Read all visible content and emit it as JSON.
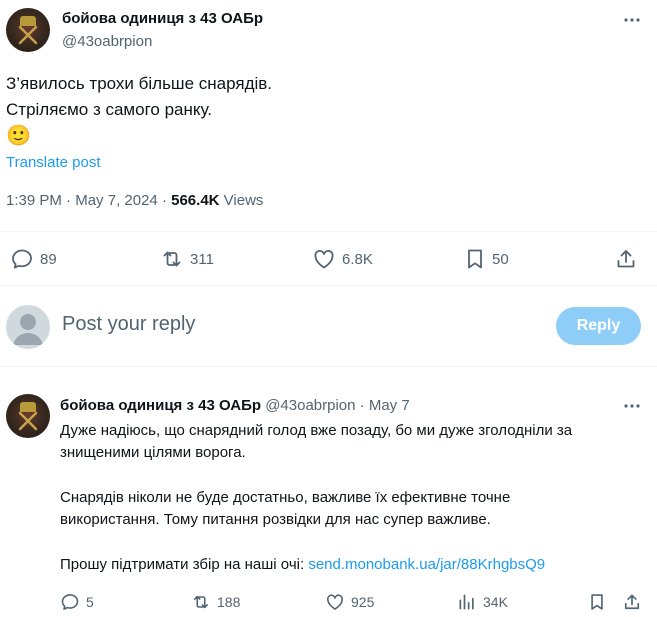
{
  "main_tweet": {
    "author_name": "бойова одиниця з 43 ОАБр",
    "handle": "@43oabrpion",
    "line1": "З’явилось трохи більше снарядів.",
    "line2": "Стріляємо з самого ранку.",
    "emoji": "🙂",
    "translate_label": "Translate post",
    "time": "1:39 PM",
    "dot": "·",
    "date": "May 7, 2024",
    "views_count": "566.4K",
    "views_label": "Views",
    "replies": "89",
    "reposts": "311",
    "likes": "6.8K",
    "bookmarks": "50"
  },
  "composer": {
    "placeholder": "Post your reply",
    "button_label": "Reply",
    "button_color": "#8ecdf8"
  },
  "reply_tweet": {
    "author_name": "бойова одиниця з 43 ОАБр",
    "handle": "@43oabrpion",
    "dot": "·",
    "date": "May 7",
    "para1_line1": "Дуже надіюсь, що снарядний голод вже позаду, бо ми дуже зголодніли за",
    "para1_line2": "знищеними цілями ворога.",
    "para2_line1": "Снарядів ніколи не буде достатньо, важливе їх ефективне точне",
    "para2_line2": "використання. Тому питання розвідки для нас супер важливе.",
    "para3_text": "Прошу підтримати збір на наші очі: ",
    "para3_link": "send.monobank.ua/jar/88KrhgbsQ9",
    "replies": "5",
    "reposts": "188",
    "likes": "925",
    "views": "34K"
  },
  "colors": {
    "accent": "#1d9bf0",
    "secondary_text": "#536471",
    "divider": "#eff3f4"
  },
  "icons": [
    "more-icon",
    "reply-icon",
    "repost-icon",
    "like-icon",
    "bookmark-icon",
    "share-icon",
    "views-icon"
  ]
}
